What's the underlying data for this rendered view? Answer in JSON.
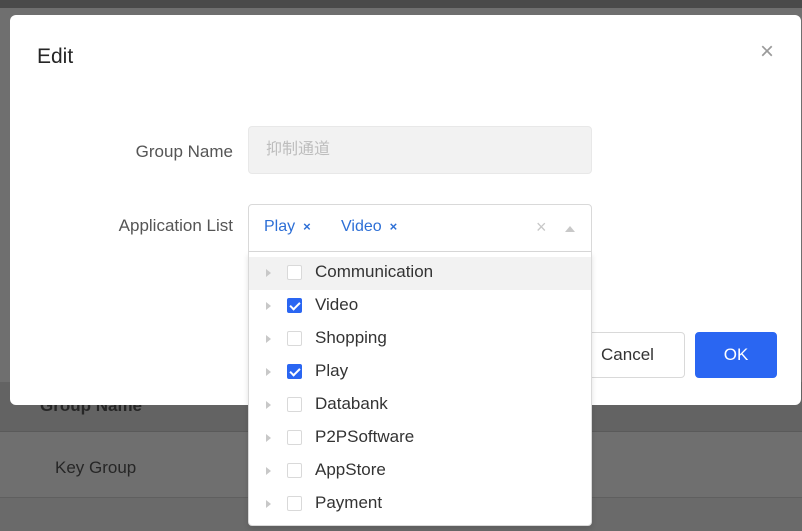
{
  "background": {
    "group_name_header": "Group Name",
    "key_group": "Key Group"
  },
  "modal": {
    "title": "Edit",
    "close_glyph": "×"
  },
  "form": {
    "group_name_label": "Group Name",
    "group_name_value": "抑制通道",
    "application_list_label": "Application List",
    "selected_tags": [
      "Play",
      "Video"
    ],
    "tag_remove_glyph": "×",
    "clear_glyph": "×"
  },
  "dropdown": {
    "items": [
      {
        "label": "Communication",
        "checked": false
      },
      {
        "label": "Video",
        "checked": true
      },
      {
        "label": "Shopping",
        "checked": false
      },
      {
        "label": "Play",
        "checked": true
      },
      {
        "label": "Databank",
        "checked": false
      },
      {
        "label": "P2PSoftware",
        "checked": false
      },
      {
        "label": "AppStore",
        "checked": false
      },
      {
        "label": "Payment",
        "checked": false
      }
    ]
  },
  "buttons": {
    "cancel": "Cancel",
    "ok": "OK"
  },
  "colors": {
    "accent": "#2a66f2",
    "tag_text": "#2d6fd6"
  },
  "icons": [
    "close-icon",
    "tag-remove-icon",
    "clear-icon",
    "chevron-up-icon",
    "expand-caret-icon",
    "checkbox-icon"
  ]
}
